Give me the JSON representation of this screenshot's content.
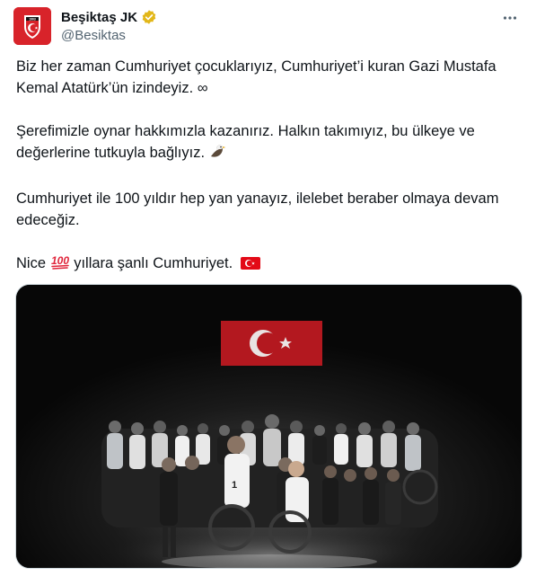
{
  "account": {
    "name": "Beşiktaş JK",
    "handle": "@Besiktas"
  },
  "tweet": {
    "p1": "Biz her zaman Cumhuriyet çocuklarıyız, Cumhuriyet’i kuran Gazi Mustafa Kemal Atatürk’ün izindeyiz. ∞",
    "p2": "Şerefimizle oynar hakkımızla kazanırız. Halkın takımıyız, bu ülkeye ve değerlerine tutkuyla bağlıyız.",
    "p3": "Cumhuriyet ile 100 yıldır hep yan yanayız, ilelebet beraber olmaya devam edeceğiz.",
    "p4_before": "Nice",
    "p4_after": "yıllara şanlı Cumhuriyet."
  },
  "icons": {
    "verified": "verified-gold-badge-icon",
    "more": "more-dots-icon",
    "eagle": "eagle-emoji",
    "hundred": "hundred-points-emoji",
    "flag": "turkey-flag-emoji"
  },
  "colors": {
    "brand_red": "#d8232a",
    "badge_gold": "#e2b719",
    "text": "#0f1419",
    "muted": "#536471"
  }
}
